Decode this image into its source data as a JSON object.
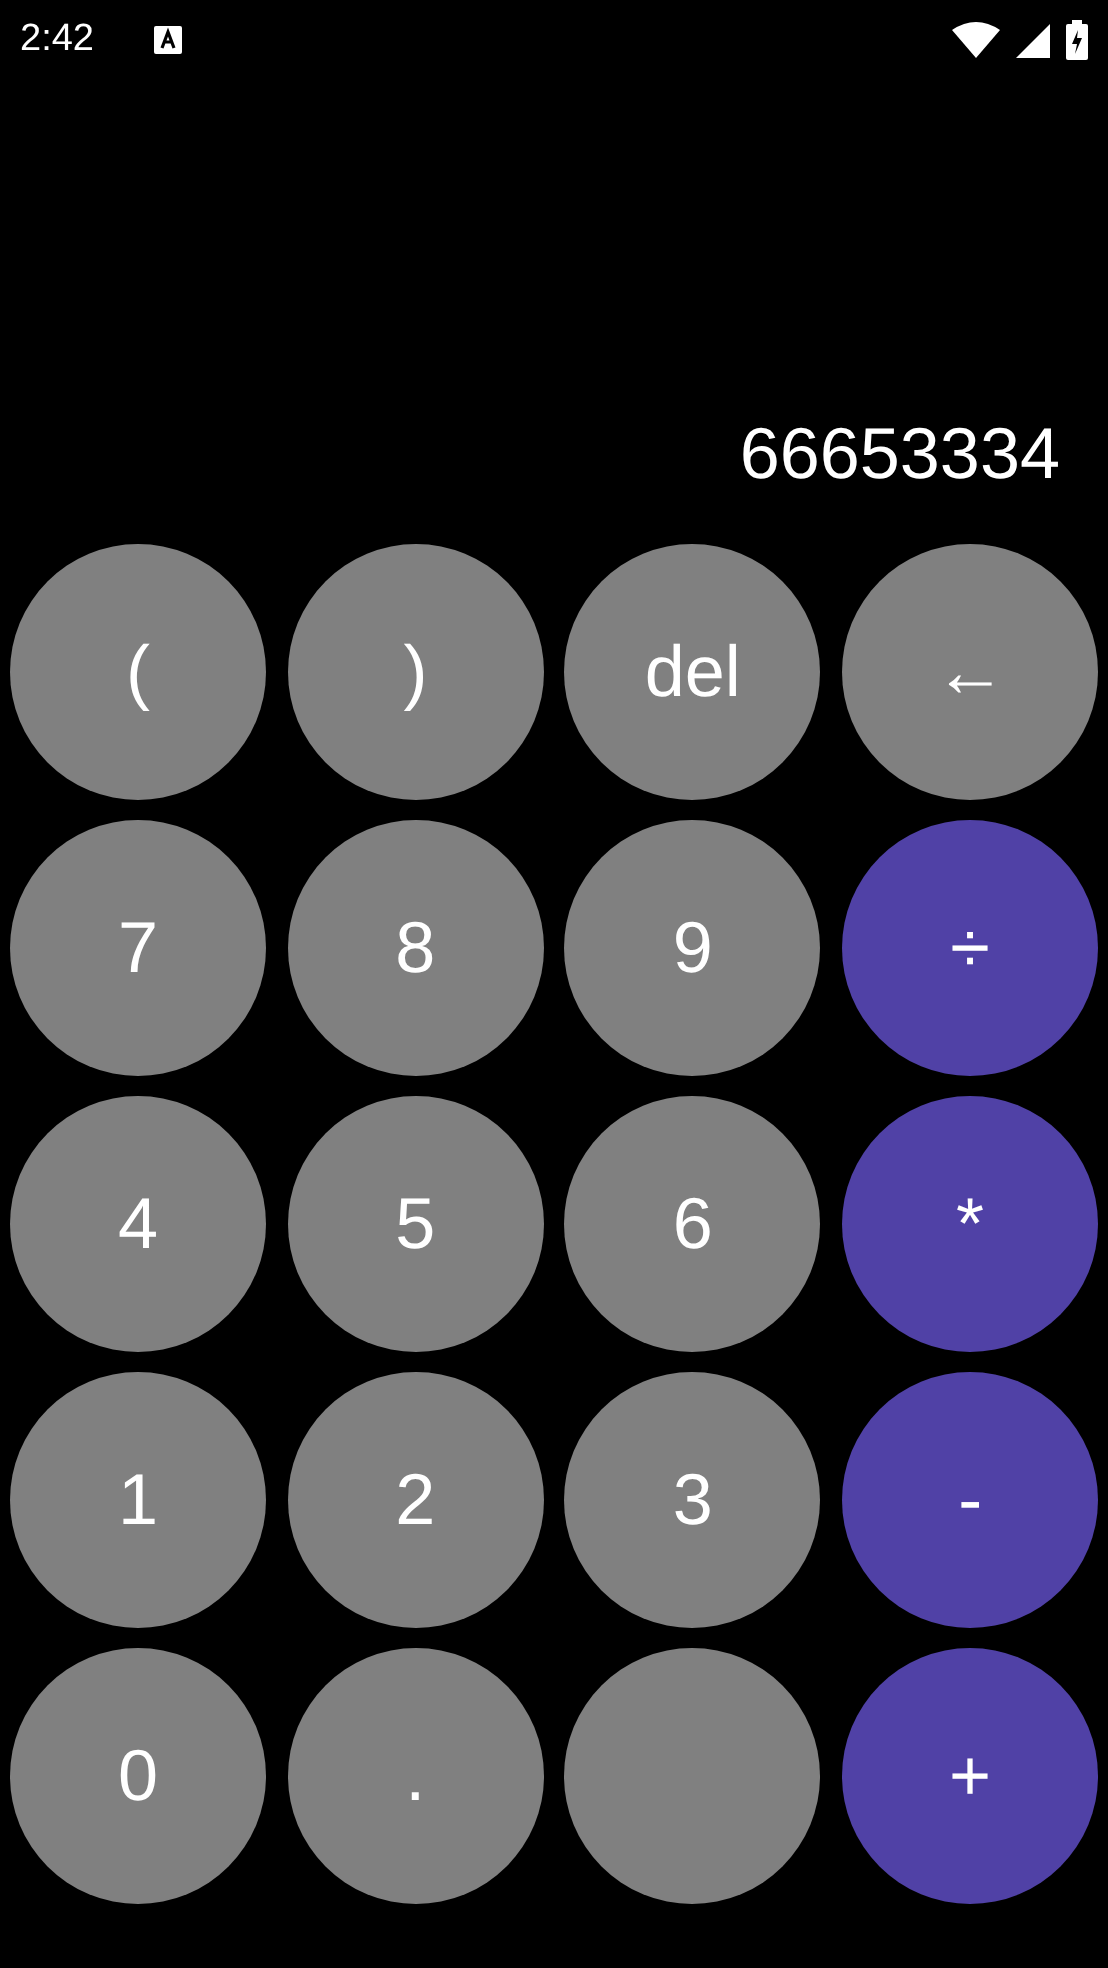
{
  "status_bar": {
    "time": "2:42"
  },
  "display": {
    "value": "66653334"
  },
  "keys": [
    {
      "label": "(",
      "kind": "function"
    },
    {
      "label": ")",
      "kind": "function"
    },
    {
      "label": "del",
      "kind": "function"
    },
    {
      "label": "←",
      "kind": "function"
    },
    {
      "label": "7",
      "kind": "digit"
    },
    {
      "label": "8",
      "kind": "digit"
    },
    {
      "label": "9",
      "kind": "digit"
    },
    {
      "label": "÷",
      "kind": "operator"
    },
    {
      "label": "4",
      "kind": "digit"
    },
    {
      "label": "5",
      "kind": "digit"
    },
    {
      "label": "6",
      "kind": "digit"
    },
    {
      "label": "*",
      "kind": "operator"
    },
    {
      "label": "1",
      "kind": "digit"
    },
    {
      "label": "2",
      "kind": "digit"
    },
    {
      "label": "3",
      "kind": "digit"
    },
    {
      "label": "-",
      "kind": "operator"
    },
    {
      "label": "0",
      "kind": "digit"
    },
    {
      "label": ".",
      "kind": "digit"
    },
    {
      "kind": "function"
    },
    {
      "label": "+",
      "kind": "operator"
    }
  ]
}
